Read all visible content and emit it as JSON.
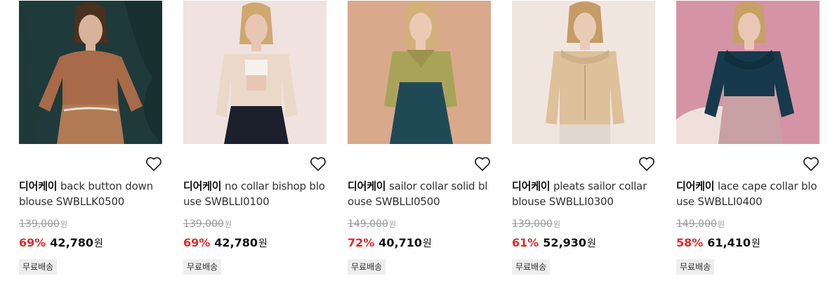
{
  "products": [
    {
      "brand": "디어케이",
      "name": "back button down blouse SWBLLK0500",
      "original_price": "139,000",
      "original_unit": "원",
      "discount": "69%",
      "sale_price": "42,780",
      "sale_unit": "원",
      "badge": "무료배송",
      "colors": {
        "bg": "#1f3a3a",
        "top": "#a86a48",
        "bottom": "#b07a54",
        "hair": "#4a3020",
        "skin": "#d8b29a"
      }
    },
    {
      "brand": "디어케이",
      "name": "no collar bishop blouse SWBLLI0100",
      "original_price": "139,000",
      "original_unit": "원",
      "discount": "69%",
      "sale_price": "42,780",
      "sale_unit": "원",
      "badge": "무료배송",
      "colors": {
        "bg": "#efe2df",
        "top": "#ead8c8",
        "bottom": "#1c1f2c",
        "hair": "#cfa870",
        "skin": "#e7c7b4"
      }
    },
    {
      "brand": "디어케이",
      "name": "sailor collar solid blouse SWBLLI0500",
      "original_price": "149,000",
      "original_unit": "원",
      "discount": "72%",
      "sale_price": "40,710",
      "sale_unit": "원",
      "badge": "무료배송",
      "colors": {
        "bg": "#d9a98c",
        "top": "#a9a35a",
        "bottom": "#1f4a55",
        "hair": "#d3b07a",
        "skin": "#ecc9b3"
      }
    },
    {
      "brand": "디어케이",
      "name": "pleats sailor collar blouse SWBLLI0300",
      "original_price": "139,000",
      "original_unit": "원",
      "discount": "61%",
      "sale_price": "52,930",
      "sale_unit": "원",
      "badge": "무료배송",
      "colors": {
        "bg": "#f1e5df",
        "top": "#dcc19a",
        "bottom": "#dcc19a",
        "hair": "#c39c66",
        "skin": "#eacbb6"
      }
    },
    {
      "brand": "디어케이",
      "name": "lace cape collar blouse SWBLLI0400",
      "original_price": "149,000",
      "original_unit": "원",
      "discount": "58%",
      "sale_price": "61,410",
      "sale_unit": "원",
      "badge": "무료배송",
      "colors": {
        "bg": "#d494a6",
        "top": "#163a4c",
        "bottom": "#c9a0a4",
        "hair": "#c7a066",
        "skin": "#e9c7b4"
      }
    }
  ],
  "icons": {
    "wishlist": "heart-outline-icon"
  }
}
